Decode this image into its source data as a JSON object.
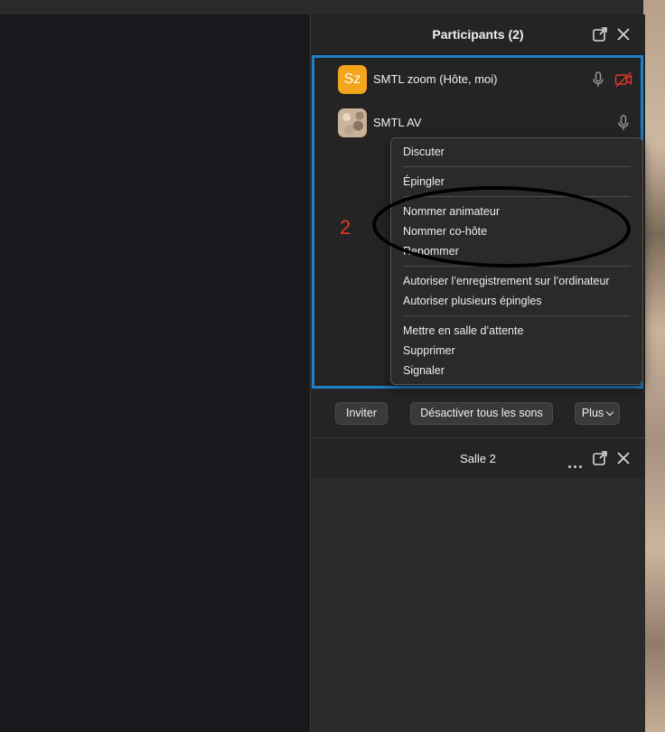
{
  "participants_panel": {
    "title": "Participants (2)",
    "participants": [
      {
        "avatar_text": "Sz",
        "avatar_color": "#f3a51b",
        "name": "SMTL zoom (Hôte, moi)",
        "audio_icon": "microphone-icon",
        "video_icon": "video-off-icon"
      },
      {
        "avatar_text": "",
        "name": "SMTL AV",
        "audio_icon": "microphone-icon"
      }
    ],
    "annotation_number": "2",
    "context_menu": {
      "groups": [
        [
          "Discuter"
        ],
        [
          "Épingler"
        ],
        [
          "Nommer animateur",
          "Nommer co-hôte",
          "Renommer"
        ],
        [
          "Autoriser l’enregistrement sur l’ordinateur",
          "Autoriser plusieurs épingles"
        ],
        [
          "Mettre en salle d’attente",
          "Supprimer",
          "Signaler"
        ]
      ]
    },
    "footer_buttons": {
      "invite": "Inviter",
      "mute_all": "Désactiver tous les sons",
      "more": "Plus"
    }
  },
  "breakout_panel": {
    "title": "Salle 2"
  },
  "colors": {
    "highlight_border": "#1f7fc4",
    "annotation_red": "#e0392c",
    "video_off_red": "#e0392c"
  }
}
